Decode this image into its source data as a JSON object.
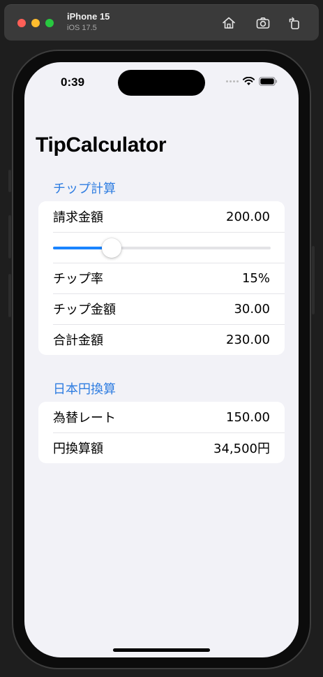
{
  "simulator": {
    "device_name": "iPhone 15",
    "os_version": "iOS 17.5",
    "toolbar_icons": [
      "home-icon",
      "screenshot-icon",
      "rotate-icon"
    ]
  },
  "status_bar": {
    "time": "0:39",
    "icons": [
      "signal-dots-icon",
      "wifi-icon",
      "battery-icon"
    ]
  },
  "nav": {
    "title": "TipCalculator"
  },
  "tip_section": {
    "header": "チップ計算",
    "bill_label": "請求金額",
    "bill_value": "200.00",
    "slider_level": 0.27,
    "tip_rate_label": "チップ率",
    "tip_rate_value": "15%",
    "tip_amount_label": "チップ金額",
    "tip_amount_value": "30.00",
    "total_label": "合計金額",
    "total_value": "230.00"
  },
  "yen_section": {
    "header": "日本円換算",
    "rate_label": "為替レート",
    "rate_value": "150.00",
    "converted_label": "円換算額",
    "converted_value": "34,500円"
  },
  "colors": {
    "accent": "#1a84ff",
    "section_header": "#2f7de1",
    "background": "#f2f2f7"
  }
}
